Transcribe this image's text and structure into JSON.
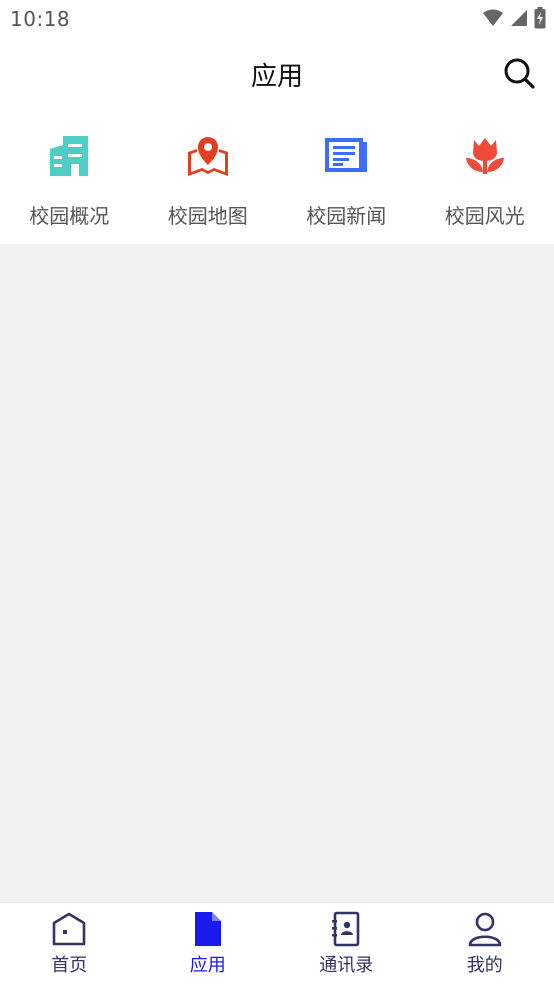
{
  "status_bar": {
    "time": "10:18"
  },
  "header": {
    "title": "应用",
    "search_icon": "search-icon"
  },
  "apps": [
    {
      "label": "校园概况",
      "icon": "building-icon",
      "color": "#4ecdc4"
    },
    {
      "label": "校园地图",
      "icon": "map-pin-icon",
      "color": "#e0401f"
    },
    {
      "label": "校园新闻",
      "icon": "newspaper-icon",
      "color": "#3b6ff5"
    },
    {
      "label": "校园风光",
      "icon": "tulip-icon",
      "color": "#ee4b3a"
    }
  ],
  "bottom_nav": {
    "items": [
      {
        "label": "首页",
        "icon": "home-icon",
        "active": false
      },
      {
        "label": "应用",
        "icon": "document-icon",
        "active": true
      },
      {
        "label": "通讯录",
        "icon": "contacts-book-icon",
        "active": false
      },
      {
        "label": "我的",
        "icon": "user-icon",
        "active": false
      }
    ],
    "active_color": "#1a1aee",
    "inactive_color": "#333366"
  }
}
